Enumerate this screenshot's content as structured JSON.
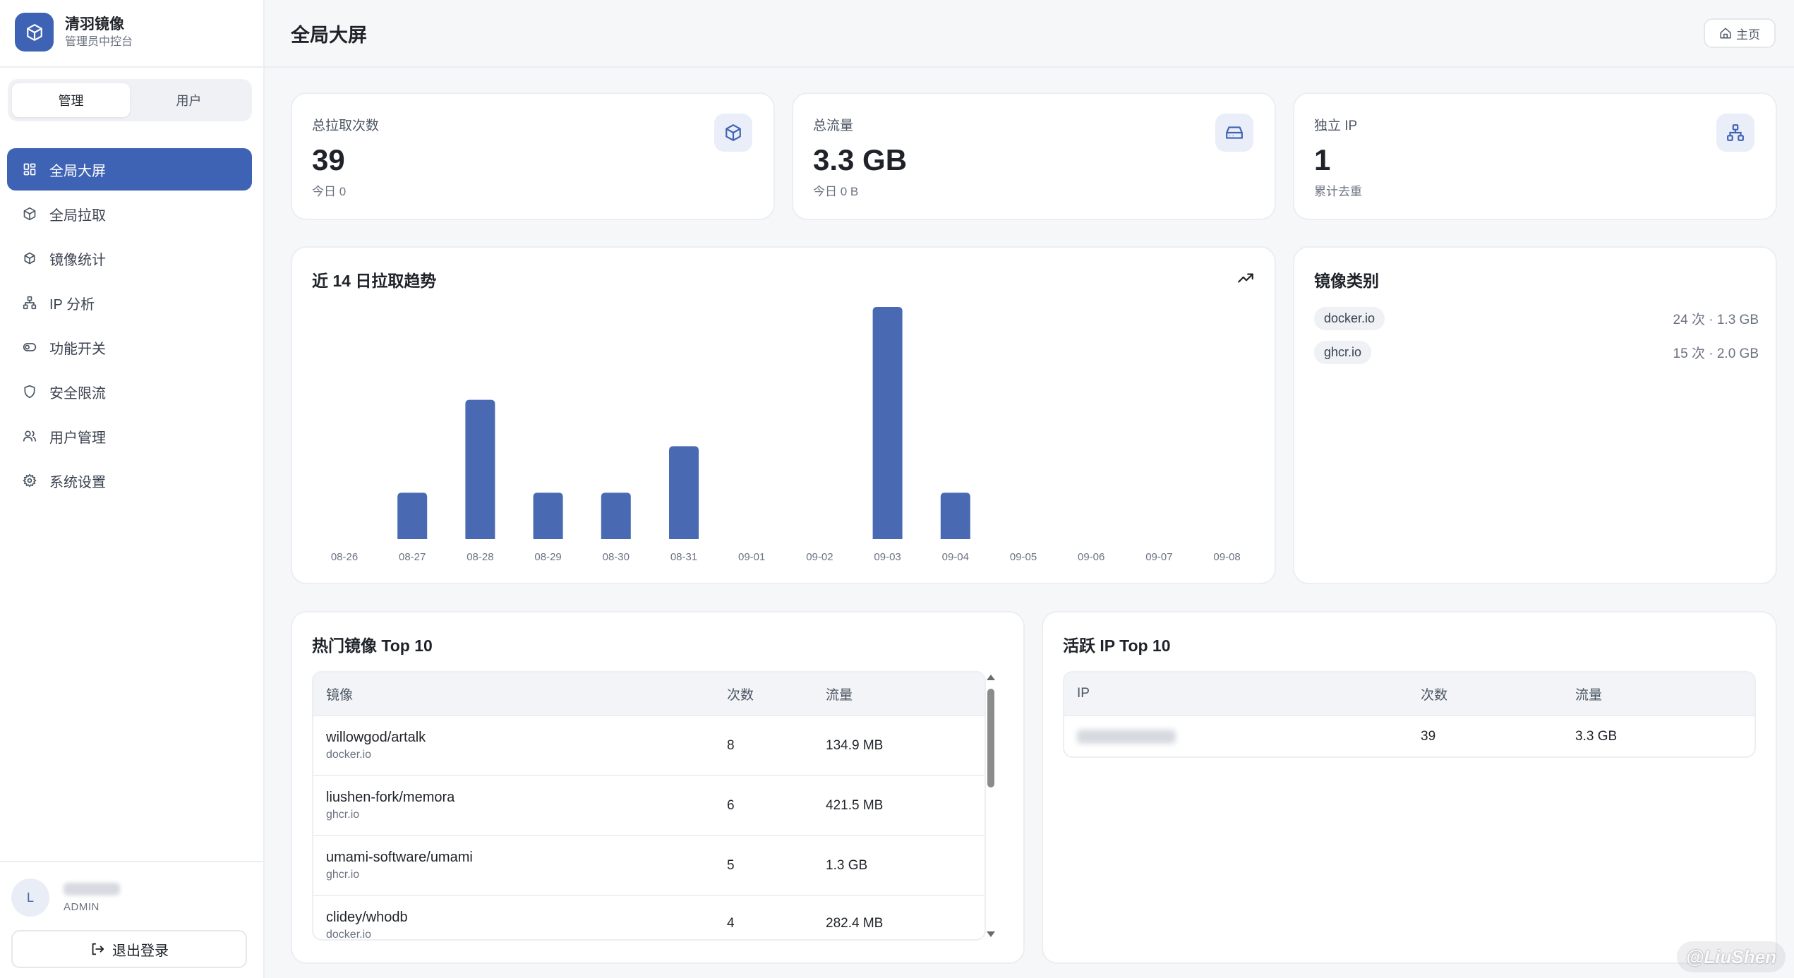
{
  "brand": {
    "name": "清羽镜像",
    "subtitle": "管理员中控台"
  },
  "sidebar": {
    "tabs": [
      {
        "label": "管理",
        "active": true
      },
      {
        "label": "用户",
        "active": false
      }
    ],
    "items": [
      {
        "label": "全局大屏",
        "icon": "dashboard-icon",
        "active": true
      },
      {
        "label": "全局拉取",
        "icon": "cube-icon"
      },
      {
        "label": "镜像统计",
        "icon": "cube-stack-icon"
      },
      {
        "label": "IP 分析",
        "icon": "network-icon"
      },
      {
        "label": "功能开关",
        "icon": "toggle-icon"
      },
      {
        "label": "安全限流",
        "icon": "shield-icon"
      },
      {
        "label": "用户管理",
        "icon": "users-icon"
      },
      {
        "label": "系统设置",
        "icon": "gear-icon"
      }
    ],
    "user": {
      "initial": "L",
      "role": "ADMIN"
    },
    "logout_label": "退出登录"
  },
  "header": {
    "title": "全局大屏",
    "home_label": "主页"
  },
  "stats": [
    {
      "label": "总拉取次数",
      "value": "39",
      "sub": "今日 0",
      "icon": "cube-icon"
    },
    {
      "label": "总流量",
      "value": "3.3 GB",
      "sub": "今日 0 B",
      "icon": "drive-icon"
    },
    {
      "label": "独立 IP",
      "value": "1",
      "sub": "累计去重",
      "icon": "network-icon"
    }
  ],
  "trend": {
    "title": "近 14 日拉取趋势",
    "icon": "trend-up-icon"
  },
  "chart_data": {
    "type": "bar",
    "categories": [
      "08-26",
      "08-27",
      "08-28",
      "08-29",
      "08-30",
      "08-31",
      "09-01",
      "09-02",
      "09-03",
      "09-04",
      "09-05",
      "09-06",
      "09-07",
      "09-08"
    ],
    "values": [
      0,
      3,
      9,
      3,
      3,
      6,
      0,
      0,
      15,
      3,
      0,
      0,
      0,
      0
    ],
    "ylim": [
      0,
      15
    ],
    "color": "#4a69b3",
    "grid": false
  },
  "categories_card": {
    "title": "镜像类别",
    "items": [
      {
        "registry": "docker.io",
        "stat": "24 次 · 1.3 GB"
      },
      {
        "registry": "ghcr.io",
        "stat": "15 次 · 2.0 GB"
      }
    ]
  },
  "top_images": {
    "title": "热门镜像 Top 10",
    "columns": [
      "镜像",
      "次数",
      "流量"
    ],
    "rows": [
      {
        "name": "willowgod/artalk",
        "registry": "docker.io",
        "count": "8",
        "traffic": "134.9 MB"
      },
      {
        "name": "liushen-fork/memora",
        "registry": "ghcr.io",
        "count": "6",
        "traffic": "421.5 MB"
      },
      {
        "name": "umami-software/umami",
        "registry": "ghcr.io",
        "count": "5",
        "traffic": "1.3 GB"
      },
      {
        "name": "clidey/whodb",
        "registry": "docker.io",
        "count": "4",
        "traffic": "282.4 MB"
      }
    ]
  },
  "top_ips": {
    "title": "活跃 IP Top 10",
    "columns": [
      "IP",
      "次数",
      "流量"
    ],
    "rows": [
      {
        "count": "39",
        "traffic": "3.3 GB"
      }
    ]
  },
  "watermark": "@LiuShen",
  "colors": {
    "accent": "#3f63b4",
    "bar": "#4a69b3",
    "background": "#f6f7f9"
  }
}
